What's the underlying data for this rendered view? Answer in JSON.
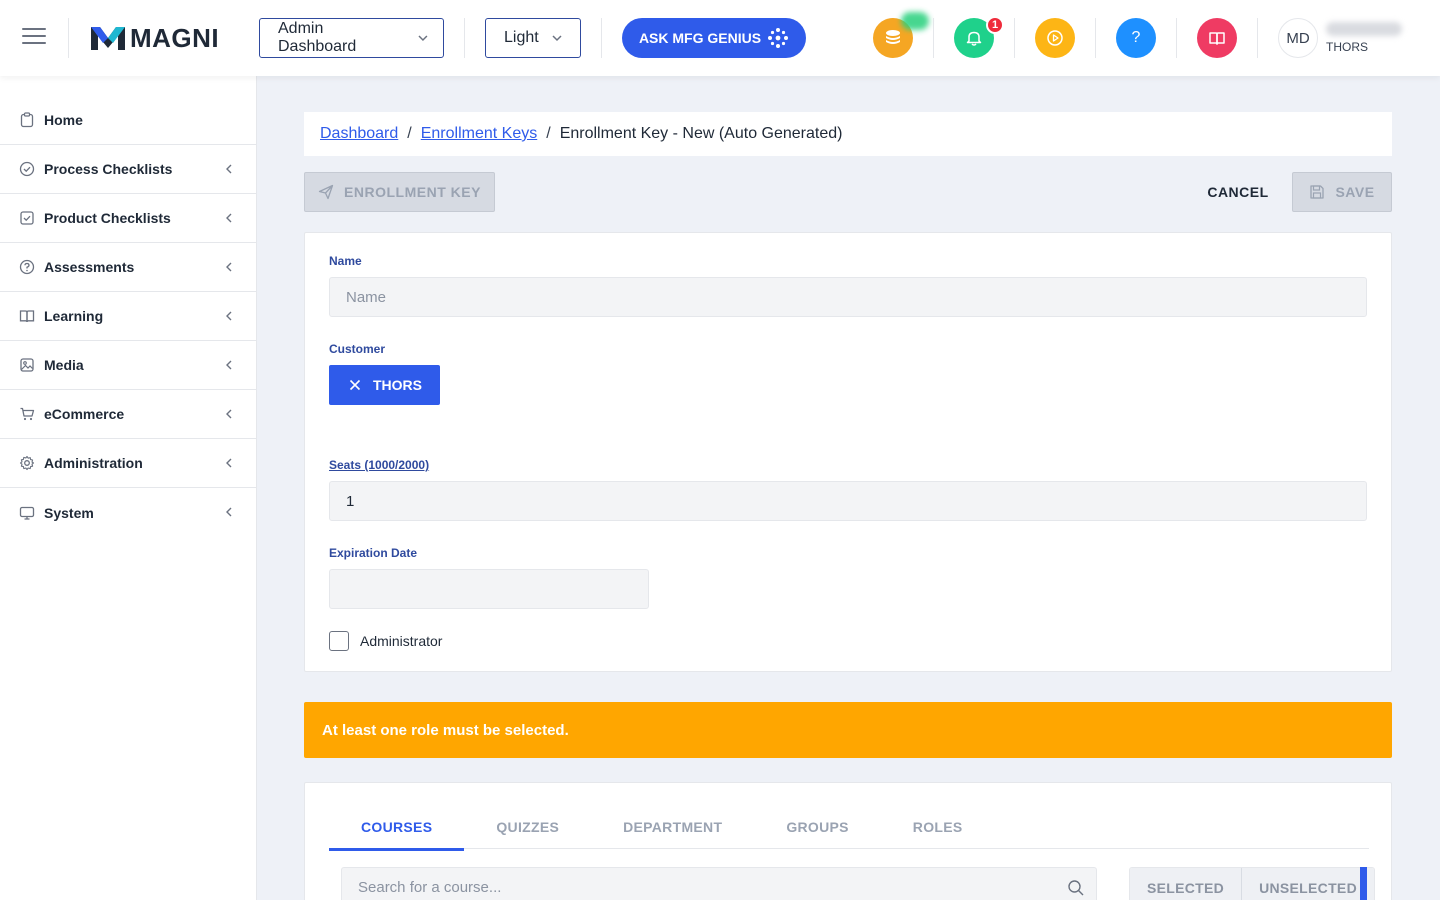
{
  "header": {
    "logo_text": "MAGNI",
    "view_select": "Admin Dashboard",
    "theme_select": "Light",
    "genius_label": "ASK MFG GENIUS",
    "notification_count": "1",
    "help_label": "?",
    "user_initials": "MD",
    "user_org": "THORS"
  },
  "sidebar": {
    "items": [
      {
        "label": "Home"
      },
      {
        "label": "Process Checklists"
      },
      {
        "label": "Product Checklists"
      },
      {
        "label": "Assessments"
      },
      {
        "label": "Learning"
      },
      {
        "label": "Media"
      },
      {
        "label": "eCommerce"
      },
      {
        "label": "Administration"
      },
      {
        "label": "System"
      }
    ]
  },
  "breadcrumb": {
    "items": [
      "Dashboard",
      "Enrollment Keys"
    ],
    "current": "Enrollment Key - New (Auto Generated)",
    "separator": "/"
  },
  "actions": {
    "enrollment_key_label": "ENROLLMENT KEY",
    "cancel_label": "CANCEL",
    "save_label": "SAVE"
  },
  "form": {
    "name_label": "Name",
    "name_placeholder": "Name",
    "name_value": "",
    "customer_label": "Customer",
    "customer_value": "THORS",
    "seats_label": "Seats (1000/2000)",
    "seats_value": "1",
    "expiration_label": "Expiration Date",
    "expiration_value": "",
    "administrator_label": "Administrator"
  },
  "alert": {
    "message": "At least one role must be selected."
  },
  "tabs": {
    "items": [
      "COURSES",
      "QUIZZES",
      "DEPARTMENT",
      "GROUPS",
      "ROLES"
    ],
    "active": "COURSES"
  },
  "list": {
    "search_placeholder": "Search for a course...",
    "filter_selected": "SELECTED",
    "filter_unselected": "UNSELECTED"
  },
  "colors": {
    "primary": "#2f5bea",
    "warning": "#ffa600",
    "coins": "#f5a623",
    "notifications": "#1fd18b",
    "media": "#fdb515",
    "help": "#1e90ff",
    "book": "#ef3b63"
  }
}
